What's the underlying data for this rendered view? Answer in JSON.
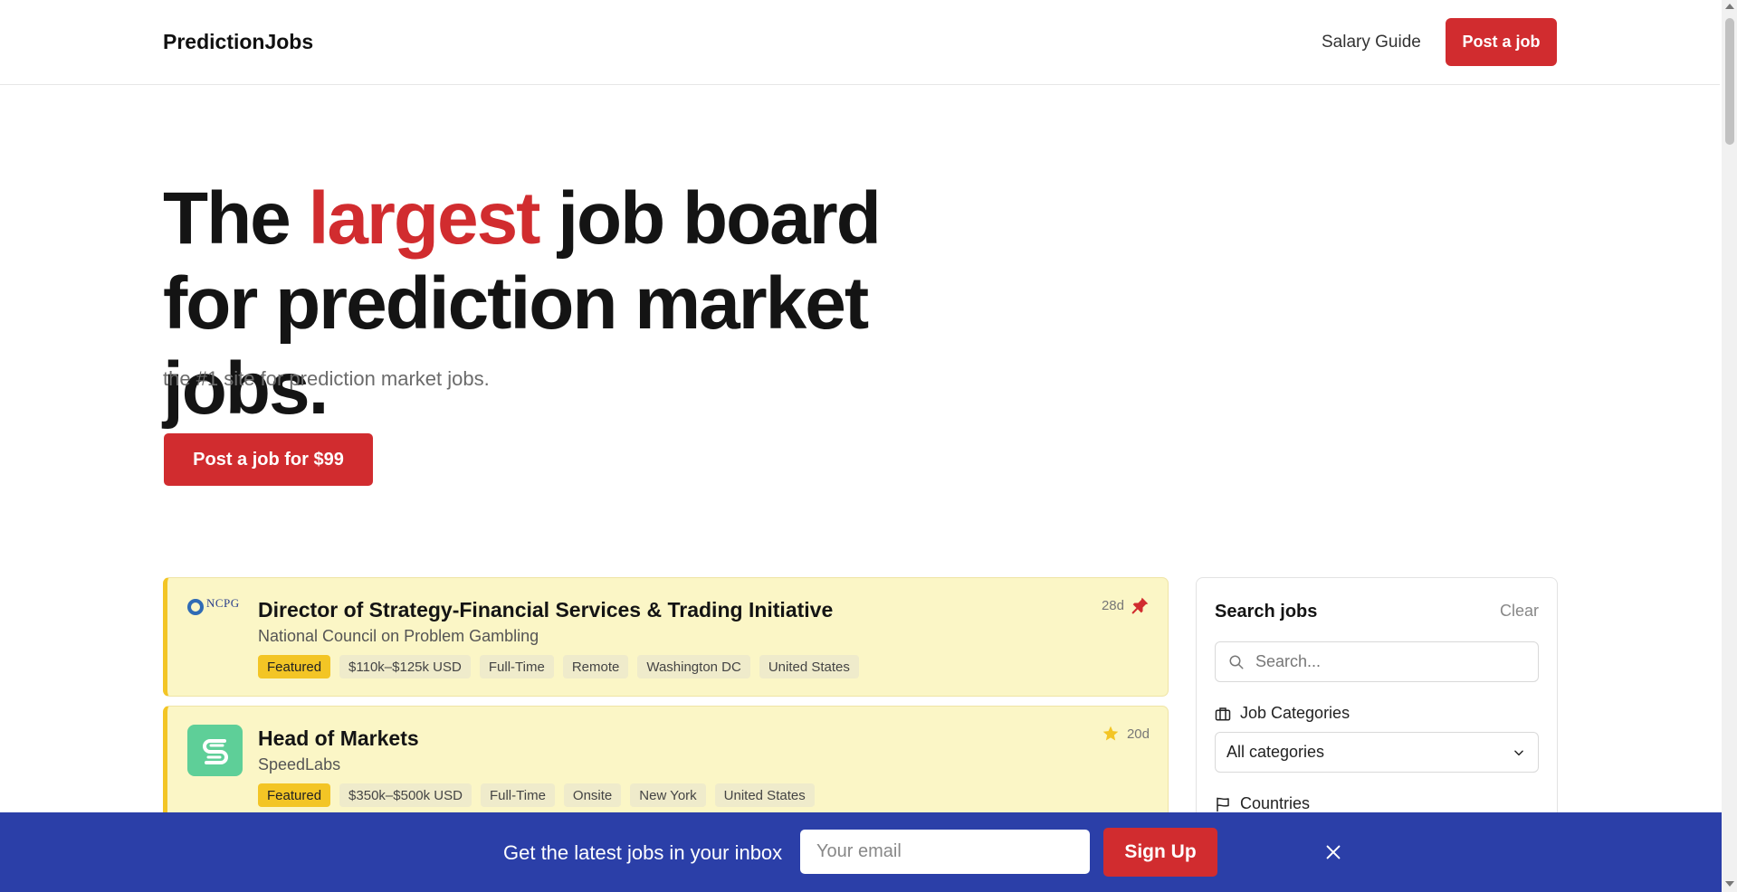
{
  "header": {
    "brand": "PredictionJobs",
    "nav_salary_guide": "Salary Guide",
    "post_job_label": "Post a job"
  },
  "hero": {
    "title_part1": "The ",
    "title_accent": "largest",
    "title_part2": " job board for prediction market jobs.",
    "subtitle": "the #1 site for prediction market jobs.",
    "cta_label": "Post a job for $99"
  },
  "jobs": [
    {
      "logo_text": "NCPG",
      "title": "Director of Strategy-Financial Services & Trading Initiative",
      "company": "National Council on Problem Gambling",
      "age": "28d",
      "meta_icon": "pin-icon",
      "tags": [
        "Featured",
        "$110k–$125k USD",
        "Full-Time",
        "Remote",
        "Washington DC",
        "United States"
      ]
    },
    {
      "logo_icon": "speedlabs-logo-icon",
      "title": "Head of Markets",
      "company": "SpeedLabs",
      "age": "20d",
      "meta_icon": "star-icon",
      "tags": [
        "Featured",
        "$350k–$500k USD",
        "Full-Time",
        "Onsite",
        "New York",
        "United States"
      ]
    }
  ],
  "sidebar": {
    "title": "Search jobs",
    "clear_label": "Clear",
    "search_placeholder": "Search...",
    "categories_label": "Job Categories",
    "categories_value": "All categories",
    "countries_label": "Countries"
  },
  "newsletter": {
    "text": "Get the latest jobs in your inbox",
    "email_placeholder": "Your email",
    "signup_label": "Sign Up"
  },
  "colors": {
    "accent": "#d12c2f",
    "featured_bg": "#fbf6c6",
    "featured_border": "#f3c525",
    "newsletter_bg": "#2b3fa8"
  }
}
